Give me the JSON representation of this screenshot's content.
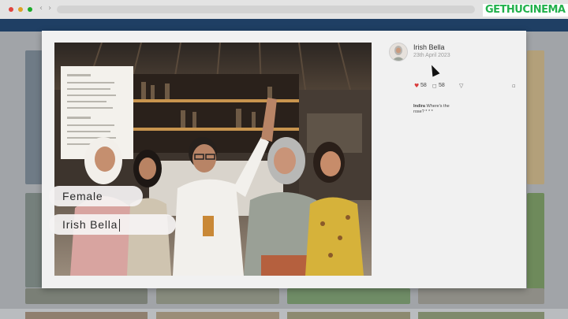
{
  "watermark": "GETHUCINEMA",
  "post": {
    "username": "Irish Bella",
    "date": "23th April 2023",
    "likes": "58",
    "comments": "58",
    "comment": {
      "author": "Indira",
      "text": "Where's the rose? * * *"
    }
  },
  "overlay": {
    "gender": "Female",
    "name": "Irish Bella"
  },
  "icons": {
    "like": "heart-icon",
    "comment": "comment-icon",
    "share": "send-icon",
    "save": "bookmark-icon"
  },
  "colors": {
    "like": "#d93a3a",
    "navbar": "#1f3f64",
    "watermark": "#22b14c"
  }
}
